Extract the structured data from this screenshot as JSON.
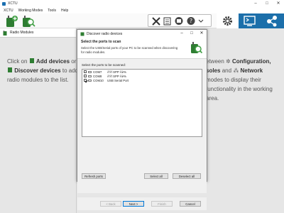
{
  "window": {
    "title": "XCTU"
  },
  "menu": {
    "items": [
      "XCTU",
      "Working Modes",
      "Tools",
      "Help"
    ]
  },
  "left_panel": {
    "header": "Radio Modules"
  },
  "hints": {
    "left_prefix": "Click on",
    "left_add": "Add devices",
    "left_or": "or",
    "left_discover": "Discover devices",
    "left_suffix": "to add radio modules to the list.",
    "right_prefix": "etween",
    "right_config": "Configuration,",
    "right_consoles": "soles",
    "right_and": "and",
    "right_network": "Network",
    "right_suffix": "modes to display their functionality in the working area."
  },
  "dialog": {
    "title": "Discover radio devices",
    "header_title": "Select the ports to scan",
    "header_desc": "Select the USB/Serial ports of your PC to be scanned when discovering for radio modules.",
    "list_label": "Select the ports to be scanned:",
    "ports": [
      {
        "name": "COM7",
        "desc": "ÄŸÍ SPP Äè%",
        "checked": false
      },
      {
        "name": "COM8",
        "desc": "ÄŸÍ SPP Äè%",
        "checked": false
      },
      {
        "name": "COM10",
        "desc": "USB Serial Port",
        "checked": true
      }
    ],
    "refresh_label": "Refresh ports",
    "select_all_label": "Select all",
    "deselect_all_label": "Deselect all",
    "back_label": "< Back",
    "next_label": "Next >",
    "finish_label": "Finish",
    "cancel_label": "Cancel"
  },
  "colors": {
    "accent": "#1c6faa",
    "panel_gray": "#e6e6e6"
  }
}
